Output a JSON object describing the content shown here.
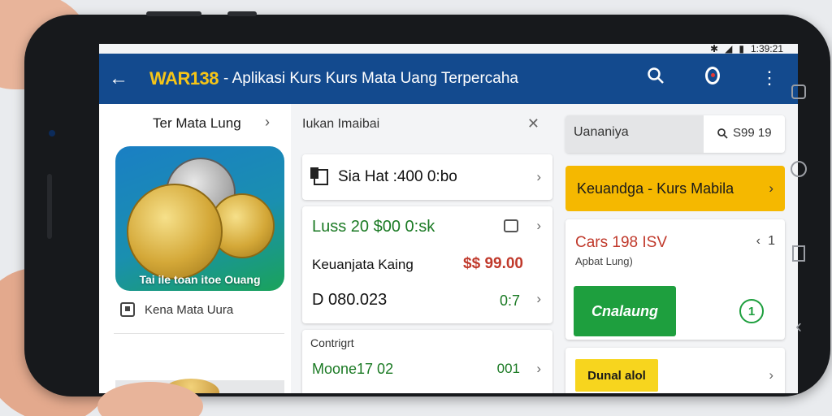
{
  "status": {
    "bluetooth": "✱",
    "signal": "◢",
    "battery": "▮",
    "time": "1:39:21"
  },
  "appbar": {
    "brand": "WAR138",
    "title": "- Aplikasi Kurs Kurs Mata Uang Terpercaha"
  },
  "left": {
    "header": "Ter Mata Lung",
    "promo_label": "Tai ile toan itoe Ouang",
    "row_label": "Kena Mata Uura"
  },
  "middle": {
    "header": "Iukan Imaibai",
    "card1": "Sia Hat :400 0:bo",
    "card2": {
      "row1": "Luss 20 $00 0:sk",
      "row2_label": "Keuanjata Kaing",
      "row2_value": "$$ 99.00",
      "row3_label": "D 080.023",
      "row3_value": "0:7"
    },
    "card3": {
      "label": "Contrigrt",
      "value": "Moone17 02",
      "value2": "001"
    }
  },
  "right": {
    "search_left": "Uananiya",
    "search_right": "S99 19",
    "yellow_bar": "Keuandga - Kurs Mabila",
    "card1": {
      "title": "Cars 198 ISV",
      "subtitle": "Apbat Lung)",
      "count": "1",
      "green_button": "Cnalaung",
      "badge": "1"
    },
    "card2": {
      "tag": "Dunal alol"
    }
  },
  "colors": {
    "appbar": "#134a8e",
    "brand": "#f5c518",
    "accent_green": "#1e9f3e",
    "accent_yellow": "#f5b800",
    "accent_red": "#c0392b"
  }
}
